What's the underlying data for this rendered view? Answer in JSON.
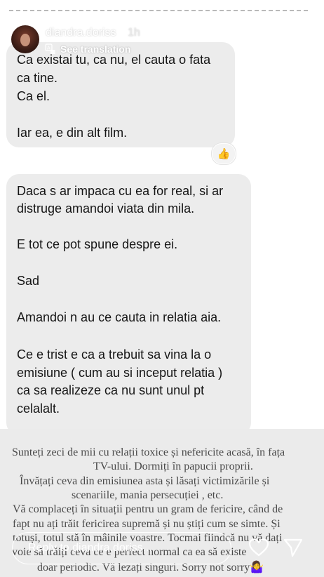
{
  "header": {
    "username": "diandra.doriss",
    "time": "1h",
    "translate_label": "See translation"
  },
  "messages": [
    {
      "lines": [
        "Ca existai tu, ca nu, el cauta o fata",
        "ca tine.",
        "Ca el.",
        "",
        "Iar ea, e din alt film."
      ],
      "reaction": "👍"
    },
    {
      "lines": [
        "Daca s ar impaca cu ea for real,  si ar",
        "distruge amandoi viata din mila.",
        "",
        "E tot ce pot spune despre ei.",
        "",
        "Sad",
        "",
        "Amandoi n au ce cauta in relatia aia.",
        "",
        "Ce e trist e ca a trebuit sa vina la o",
        "emisiune ( cum au si inceput relatia )",
        "ca sa realizeze ca nu sunt unul pt",
        "celalalt."
      ]
    }
  ],
  "caption": {
    "lines": [
      "Sunteți zeci de mii cu relații toxice și nefericite acasă, în fața",
      "TV-ului. Dormiți în papucii proprii.",
      "Învățați ceva din emisiunea asta și lăsați victimizările și",
      "scenariile, mania persecuției , etc.",
      "Vă complaceți în situații pentru un gram de fericire, când de",
      "fapt nu ați trăit fericirea supremă și nu știți cum se simte.  Și",
      "totuși, totul stă în mâinile voastre. Tocmai fiindcă nu vă dați",
      "voie să trăiți ceva ce e perfect normal ca ea să existe",
      "doar periodic. Vă lezați singuri. Sorry not sorry🤷‍♀️"
    ]
  },
  "footer": {
    "reply_placeholder": "Reply to diandra.doriss..."
  },
  "icons": {
    "play": "play-icon",
    "more": "more-icon",
    "translate": "translate-icon",
    "heart": "heart-icon",
    "send": "send-icon"
  },
  "colors": {
    "bubble": "#ececec",
    "caption_bg": "#ebebeb",
    "caption_text": "#4a4a4a",
    "overlay_text": "#ffffff"
  }
}
